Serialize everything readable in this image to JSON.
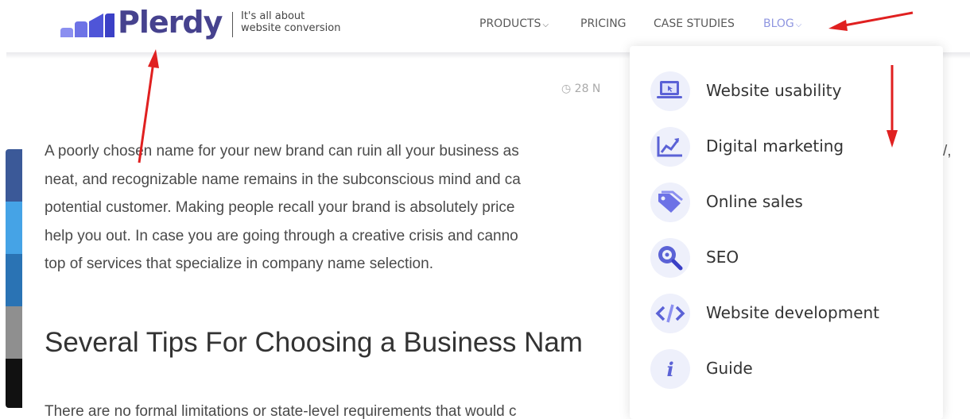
{
  "brand": {
    "name": "Plerdy",
    "tagline_line1": "It's all about",
    "tagline_line2": "website conversion"
  },
  "nav": {
    "items": [
      {
        "label": "PRODUCTS",
        "has_dropdown": true
      },
      {
        "label": "PRICING",
        "has_dropdown": false
      },
      {
        "label": "CASE STUDIES",
        "has_dropdown": false
      },
      {
        "label": "BLOG",
        "has_dropdown": true,
        "active": true
      }
    ]
  },
  "article": {
    "date": "28 N",
    "paragraph_lines": [
      "A poorly chosen name for your new brand can ruin all your business as",
      "neat, and recognizable name remains in the subconscious mind and ca",
      "potential customer. Making people recall your brand is absolutely price",
      "help you out. In case you are going through a creative crisis and canno",
      "top of services that specialize in company name selection."
    ],
    "heading": "Several Tips For Choosing a Business Nam",
    "paragraph2": "There are no formal limitations or state-level requirements that would c",
    "stray_char": "/,"
  },
  "blog_menu": {
    "items": [
      {
        "label": "Website usability",
        "icon": "laptop-icon"
      },
      {
        "label": "Digital marketing",
        "icon": "chart-icon"
      },
      {
        "label": "Online sales",
        "icon": "tag-icon"
      },
      {
        "label": "SEO",
        "icon": "magnifier-icon"
      },
      {
        "label": "Website development",
        "icon": "code-icon"
      },
      {
        "label": "Guide",
        "icon": "info-icon"
      }
    ]
  },
  "colors": {
    "brand": "#46428e",
    "accent": "#5b62d6",
    "blog_active": "#8f96e0",
    "annotation": "#e02020"
  }
}
